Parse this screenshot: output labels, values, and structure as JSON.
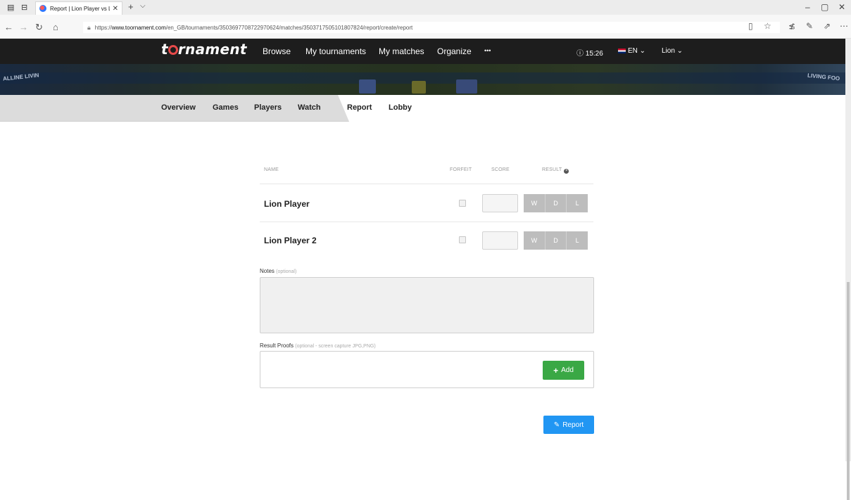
{
  "browser": {
    "tab_title": "Report | Lion Player vs L",
    "url_prefix": "https://",
    "url_domain": "www.toornament.com",
    "url_path": "/en_GB/tournaments/3503697708722970624/matches/3503717505101807824/report/create/report"
  },
  "header": {
    "logo": {
      "pre": "t",
      "post": "rnament"
    },
    "menu": [
      "Browse",
      "My tournaments",
      "My matches",
      "Organize",
      "•••"
    ],
    "time": "ⓘ 15:26",
    "lang": "EN ⌄",
    "user": "Lion ⌄"
  },
  "subnav": {
    "items": [
      "Overview",
      "Games",
      "Players",
      "Watch",
      "Report",
      "Lobby"
    ],
    "active": "Report"
  },
  "report": {
    "columns": {
      "name": "NAME",
      "forfeit": "FORFEIT",
      "score": "SCORE",
      "result": "RESULT"
    },
    "result_icon": "×",
    "result_buttons": [
      "W",
      "D",
      "L"
    ],
    "players": [
      {
        "name": "Lion Player",
        "score": ""
      },
      {
        "name": "Lion Player 2",
        "score": ""
      }
    ],
    "notes_label": "Notes",
    "notes_hint": "(optional)",
    "proofs_label": "Result Proofs",
    "proofs_hint": "(optional - screen capture JPG,PNG)",
    "add_label": "Add",
    "report_label": "Report"
  },
  "icons": {
    "add": "plus-icon",
    "report": "pencil-icon",
    "time": "clock-icon",
    "result_info": "close-circle-icon"
  },
  "colors": {
    "header_bg": "#1d1d1d",
    "subnav_bg": "#dcdcdc",
    "add_green": "#3aa845",
    "report_blue": "#2196f3",
    "result_btn_grey": "#bdbdbd"
  }
}
